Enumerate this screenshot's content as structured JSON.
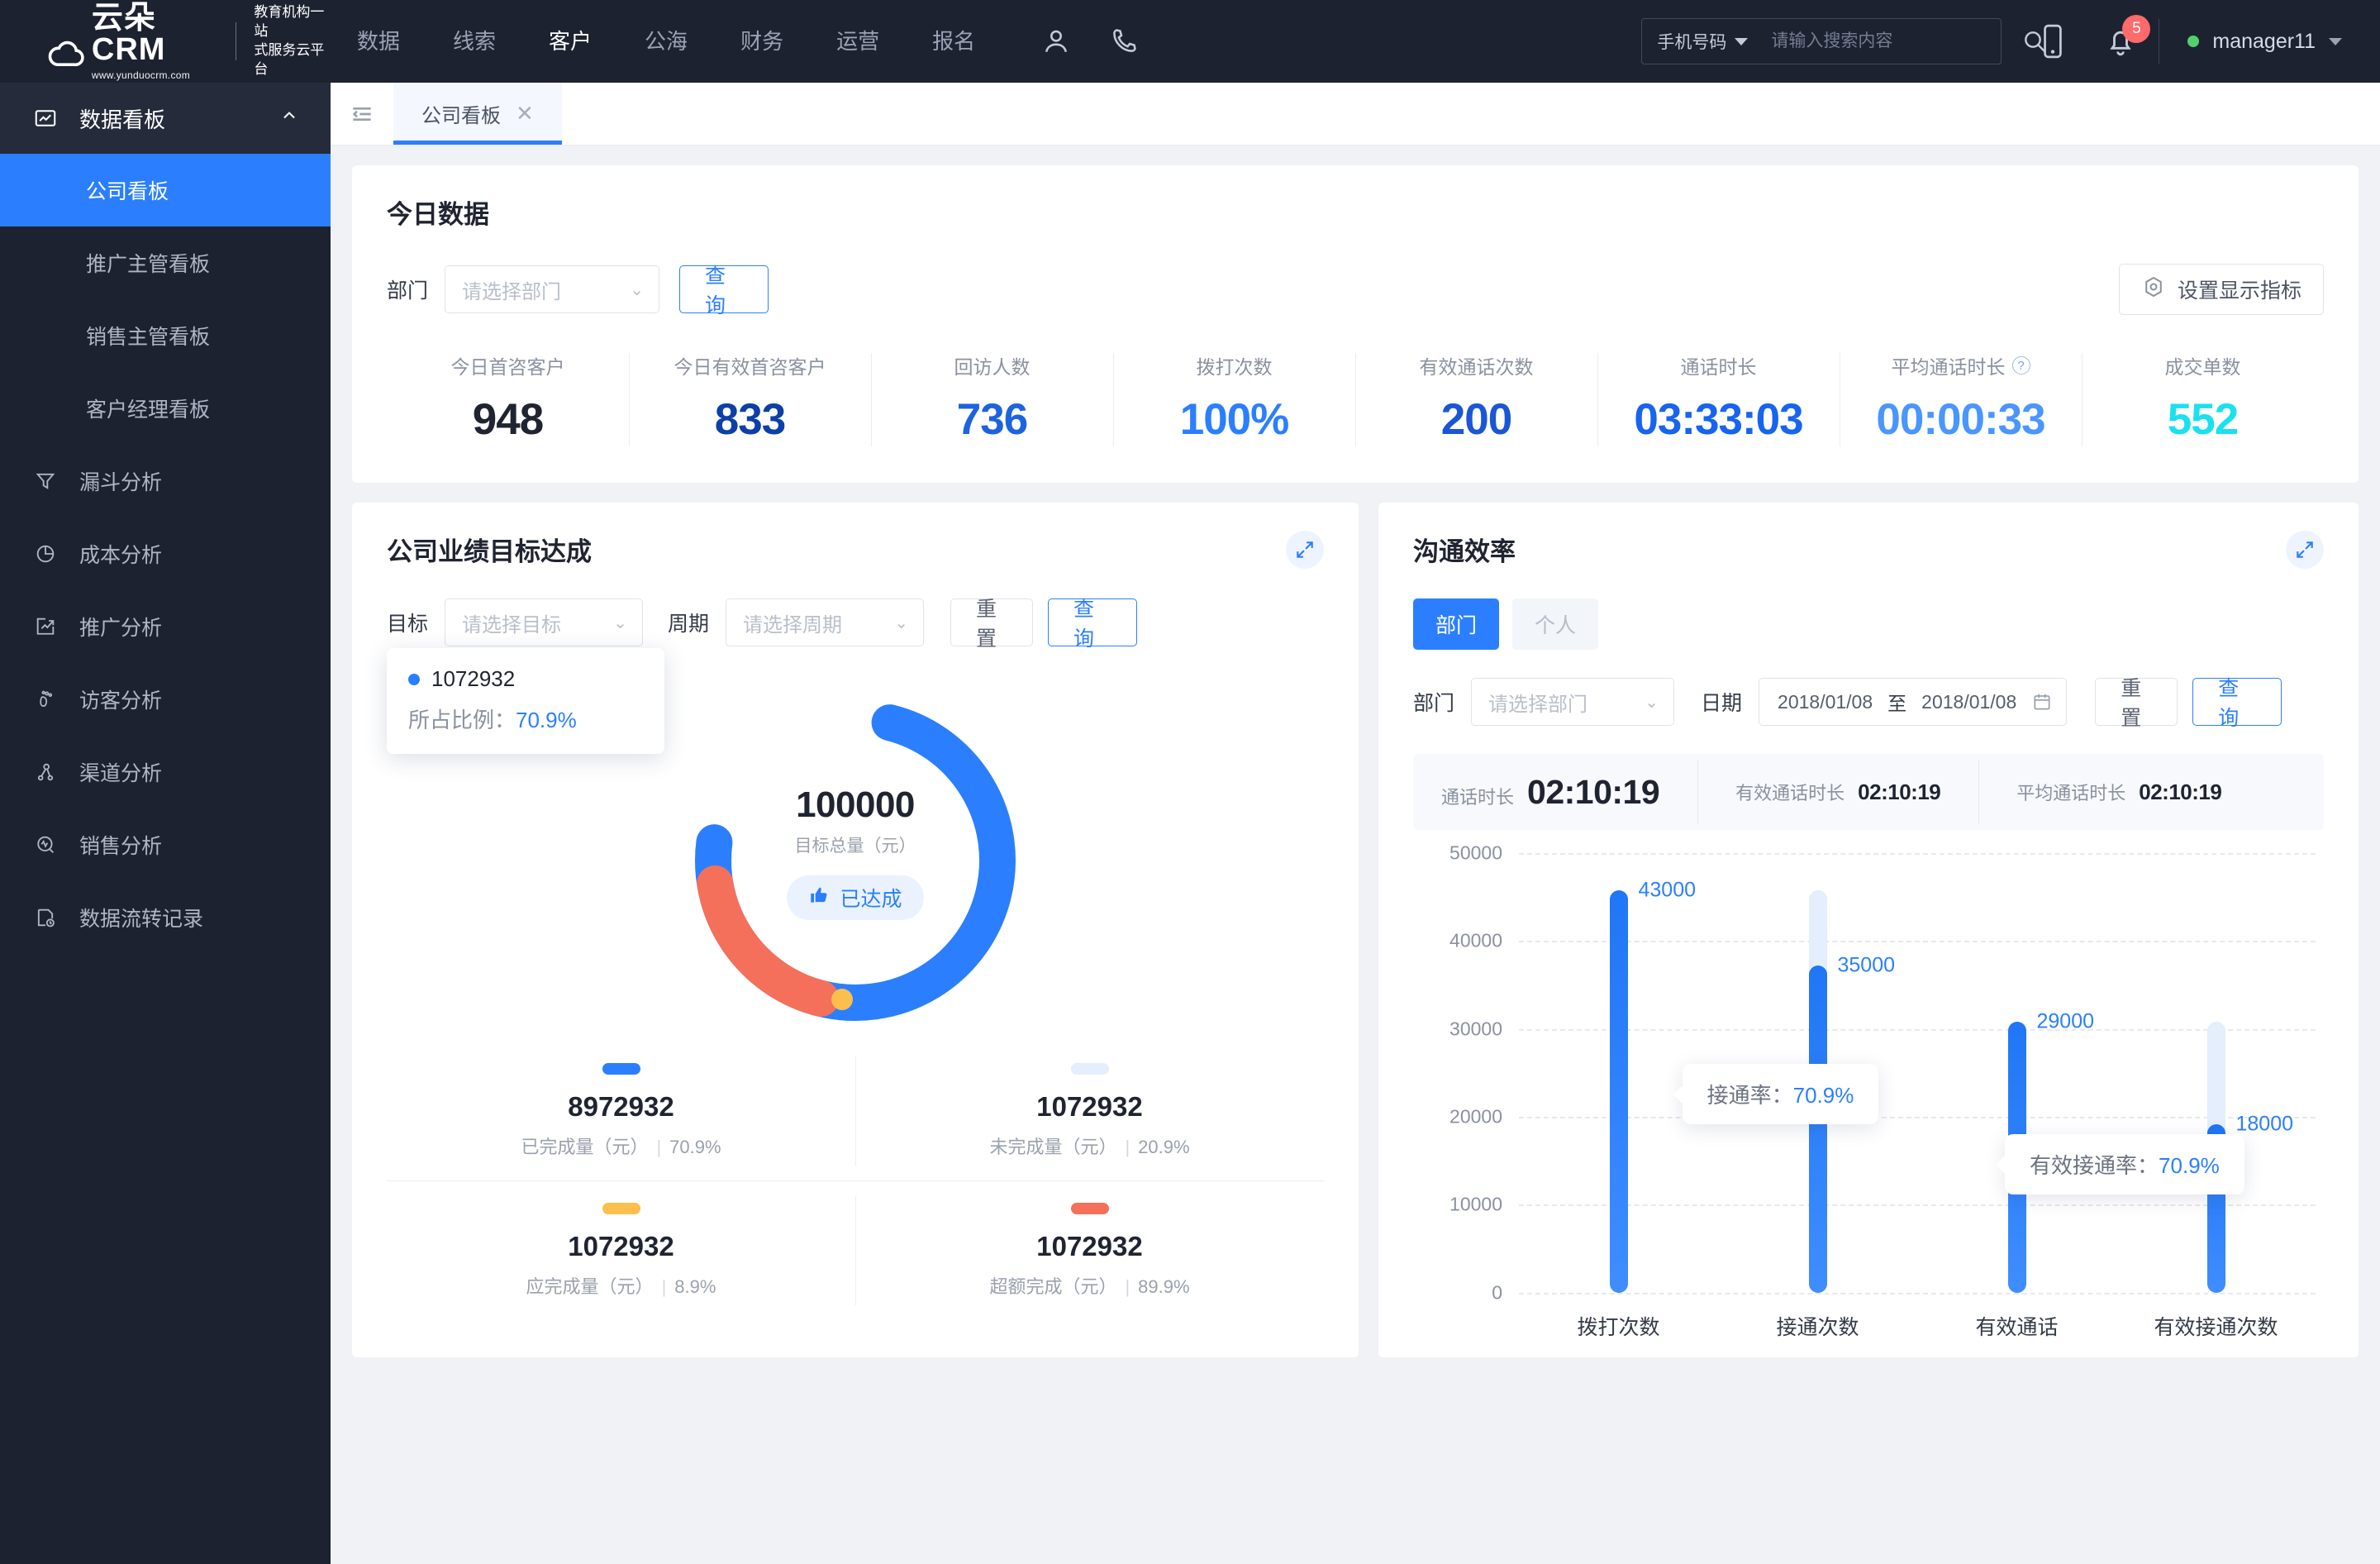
{
  "brand": {
    "name": "云朵CRM",
    "url": "www.yunduocrm.com",
    "tagline_line1": "教育机构一站",
    "tagline_line2": "式服务云平台"
  },
  "topnav": {
    "items": [
      {
        "label": "数据",
        "active": false
      },
      {
        "label": "线索",
        "active": false
      },
      {
        "label": "客户",
        "active": true
      },
      {
        "label": "公海",
        "active": false
      },
      {
        "label": "财务",
        "active": false
      },
      {
        "label": "运营",
        "active": false
      },
      {
        "label": "报名",
        "active": false
      }
    ],
    "icons": [
      "user-icon",
      "phone-icon"
    ],
    "search": {
      "type_label": "手机号码",
      "placeholder": "请输入搜索内容",
      "value": ""
    },
    "mobile_icon": "mobile-icon",
    "bell_icon": "bell-icon",
    "notification_count": "5",
    "user_name": "manager11",
    "status_color": "#52d06e"
  },
  "sidebar": {
    "group": {
      "label": "数据看板",
      "icon": "chart-board-icon",
      "expanded": true
    },
    "sub_items": [
      {
        "label": "公司看板",
        "active": true
      },
      {
        "label": "推广主管看板",
        "active": false
      },
      {
        "label": "销售主管看板",
        "active": false
      },
      {
        "label": "客户经理看板",
        "active": false
      }
    ],
    "items": [
      {
        "label": "漏斗分析",
        "icon": "funnel-icon"
      },
      {
        "label": "成本分析",
        "icon": "pie-chart-icon"
      },
      {
        "label": "推广分析",
        "icon": "trend-box-icon"
      },
      {
        "label": "访客分析",
        "icon": "footprint-icon"
      },
      {
        "label": "渠道分析",
        "icon": "network-icon"
      },
      {
        "label": "销售分析",
        "icon": "pulse-circle-icon"
      },
      {
        "label": "数据流转记录",
        "icon": "clock-doc-icon"
      }
    ]
  },
  "tabbar": {
    "collapse_icon": "collapse-menu-icon",
    "tabs": [
      {
        "label": "公司看板",
        "active": true,
        "close_icon": "close-icon"
      }
    ]
  },
  "today_card": {
    "title": "今日数据",
    "dept_label": "部门",
    "dept_placeholder": "请选择部门",
    "query_label": "查询",
    "settings_label": "设置显示指标",
    "settings_icon": "gear-hex-icon",
    "kpis": [
      {
        "label": "今日首咨客户",
        "value": "948",
        "color": "#1f2430",
        "help": false
      },
      {
        "label": "今日有效首咨客户",
        "value": "833",
        "color": "#0d3fa8",
        "help": false
      },
      {
        "label": "回访人数",
        "value": "736",
        "color": "#1d63e0",
        "help": false
      },
      {
        "label": "拨打次数",
        "value": "100%",
        "color": "#2b7fff",
        "help": false
      },
      {
        "label": "有效通话次数",
        "value": "200",
        "color": "#1a56d6",
        "help": false
      },
      {
        "label": "通话时长",
        "value": "03:33:03",
        "color": "#1764ef",
        "help": false
      },
      {
        "label": "平均通话时长",
        "value": "00:00:33",
        "color": "#4a96ff",
        "help": true
      },
      {
        "label": "成交单数",
        "value": "552",
        "color": "#1ae0f0",
        "help": false
      }
    ]
  },
  "goal_card": {
    "title": "公司业绩目标达成",
    "expand_icon": "expand-icon",
    "target_label": "目标",
    "target_placeholder": "请选择目标",
    "period_label": "周期",
    "period_placeholder": "请选择周期",
    "reset_label": "重置",
    "query_label": "查询",
    "tooltip": {
      "value": "1072932",
      "ratio_label": "所占比例：",
      "ratio": "70.9%"
    },
    "center": {
      "total": "100000",
      "caption": "目标总量（元）",
      "badge": "已达成",
      "badge_icon": "thumbs-up-icon"
    },
    "legend": [
      {
        "color": "#2b7fff",
        "value": "8972932",
        "label": "已完成量（元）",
        "pct": "70.9%"
      },
      {
        "color": "#e4eefc",
        "value": "1072932",
        "label": "未完成量（元）",
        "pct": "20.9%"
      },
      {
        "color": "#fbbf4e",
        "value": "1072932",
        "label": "应完成量（元）",
        "pct": "8.9%"
      },
      {
        "color": "#f4705a",
        "value": "1072932",
        "label": "超额完成（元）",
        "pct": "89.9%"
      }
    ]
  },
  "comm_card": {
    "title": "沟通效率",
    "expand_icon": "expand-icon",
    "toggles": [
      {
        "label": "部门",
        "active": true
      },
      {
        "label": "个人",
        "active": false
      }
    ],
    "dept_label": "部门",
    "dept_placeholder": "请选择部门",
    "date_label": "日期",
    "date_start": "2018/01/08",
    "date_sep": "至",
    "date_end": "2018/01/08",
    "calendar_icon": "calendar-icon",
    "reset_label": "重置",
    "query_label": "查询",
    "stats": [
      {
        "label": "通话时长",
        "value": "02:10:19",
        "big": true
      },
      {
        "label": "有效通话时长",
        "value": "02:10:19",
        "big": false
      },
      {
        "label": "平均通话时长",
        "value": "02:10:19",
        "big": false
      }
    ],
    "chart_data": {
      "type": "bar",
      "categories": [
        "拨打次数",
        "接通次数",
        "有效通话",
        "有效接通次数"
      ],
      "values": [
        43000,
        35000,
        29000,
        18000
      ],
      "track_value": 43000,
      "labels": [
        "43000",
        "35000",
        "29000",
        "18000"
      ],
      "yticks": [
        0,
        10000,
        20000,
        30000,
        40000,
        50000
      ],
      "ytick_labels": [
        "0",
        "10000",
        "20000",
        "30000",
        "40000",
        "50000"
      ],
      "ylim": [
        0,
        50000
      ],
      "title": "",
      "xlabel": "",
      "ylabel": "",
      "grid": true,
      "legend": "none",
      "annotations": [
        {
          "label": "接通率：",
          "value": "70.9%",
          "between": [
            0,
            1
          ],
          "y": 25000
        },
        {
          "label": "有效接通率：",
          "value": "70.9%",
          "between": [
            2,
            3
          ],
          "y": 15000
        }
      ]
    }
  }
}
